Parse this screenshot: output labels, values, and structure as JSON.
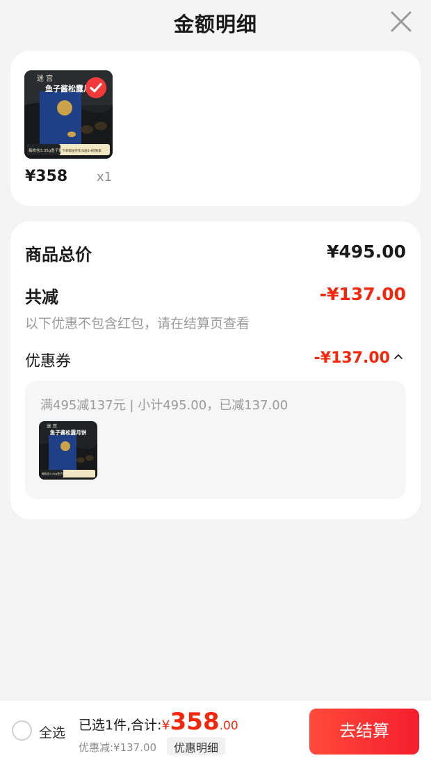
{
  "header": {
    "title": "金额明细"
  },
  "product": {
    "price": "¥358",
    "quantity": "x1",
    "image_title": "鱼子酱松露月",
    "image_title_small": "鱼子酱松露月饼",
    "image_brand": "迷 宫",
    "image_tag": "每枚含3.35g鱼子酱",
    "image_banner": "下单锁送京东派送2H到到家"
  },
  "summary": {
    "total_label": "商品总价",
    "total_value": "¥495.00",
    "reduce_label": "共减",
    "reduce_value": "-¥137.00",
    "note": "以下优惠不包含红包，请在结算页查看",
    "coupon_label": "优惠券",
    "coupon_value": "-¥137.00",
    "coupon_desc": "满495减137元 | 小计495.00，已减137.00"
  },
  "bottom": {
    "select_all": "全选",
    "total_prefix": "已选1件,合计:",
    "total_yen": "¥",
    "total_int": "358",
    "total_dec": ".00",
    "discount": "优惠减:¥137.00",
    "detail_btn": "优惠明细",
    "checkout_btn": "去结算"
  },
  "colors": {
    "accent": "#f2270c",
    "checkout": "#ff3b30",
    "background": "#f4f4f4"
  },
  "icons": {
    "close": "close-icon",
    "check": "check-circle-icon",
    "caret": "chevron-up-icon"
  }
}
